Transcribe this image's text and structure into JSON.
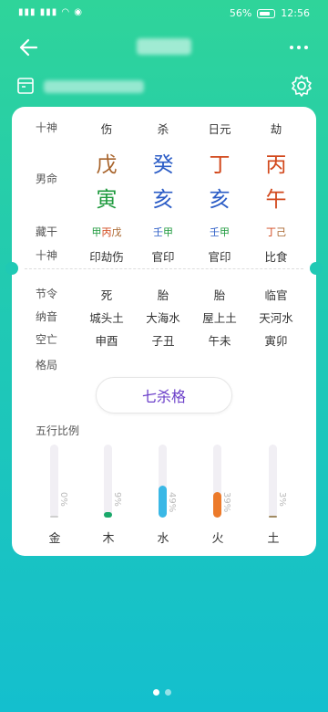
{
  "status": {
    "time": "12:56",
    "battery": "56%"
  },
  "labels": {
    "shishen_top": "十神",
    "gender": "男命",
    "canggan": "藏干",
    "shishen_bottom": "十神",
    "jieling": "节令",
    "nayin": "纳音",
    "kongwang": "空亡",
    "geju": "格局",
    "wuxing": "五行比例"
  },
  "top_shishen": [
    "伤",
    "杀",
    "日元",
    "劫"
  ],
  "tiangan": [
    {
      "char": "戊",
      "color": "#a8642c"
    },
    {
      "char": "癸",
      "color": "#2b5cc6"
    },
    {
      "char": "丁",
      "color": "#d2481c"
    },
    {
      "char": "丙",
      "color": "#d2481c"
    }
  ],
  "dizhi": [
    {
      "char": "寅",
      "color": "#1f9a3e"
    },
    {
      "char": "亥",
      "color": "#2b5cc6"
    },
    {
      "char": "亥",
      "color": "#2b5cc6"
    },
    {
      "char": "午",
      "color": "#d2481c"
    }
  ],
  "canggan": [
    [
      {
        "t": "甲",
        "c": "#1f9a3e"
      },
      {
        "t": "丙",
        "c": "#d2481c"
      },
      {
        "t": "戊",
        "c": "#a8642c"
      }
    ],
    [
      {
        "t": "壬",
        "c": "#2b5cc6"
      },
      {
        "t": "甲",
        "c": "#1f9a3e"
      }
    ],
    [
      {
        "t": "壬",
        "c": "#2b5cc6"
      },
      {
        "t": "甲",
        "c": "#1f9a3e"
      }
    ],
    [
      {
        "t": "丁",
        "c": "#d2481c"
      },
      {
        "t": "己",
        "c": "#a8642c"
      }
    ]
  ],
  "bottom_shishen": [
    "印劫伤",
    "官印",
    "官印",
    "比食"
  ],
  "jieling": [
    "死",
    "胎",
    "胎",
    "临官"
  ],
  "nayin": [
    "城头土",
    "大海水",
    "屋上土",
    "天河水"
  ],
  "kongwang": [
    "申酉",
    "子丑",
    "午未",
    "寅卯"
  ],
  "pattern": "七杀格",
  "wuxing": [
    {
      "name": "金",
      "pct": 0,
      "label": "0%",
      "color": "#cfcfcf"
    },
    {
      "name": "木",
      "pct": 9,
      "label": "9%",
      "color": "#1aa86a"
    },
    {
      "name": "水",
      "pct": 49,
      "label": "49%",
      "color": "#3ab8e6"
    },
    {
      "name": "火",
      "pct": 39,
      "label": "39%",
      "color": "#ec7a2a"
    },
    {
      "name": "土",
      "pct": 3,
      "label": "3%",
      "color": "#a08a62"
    }
  ]
}
